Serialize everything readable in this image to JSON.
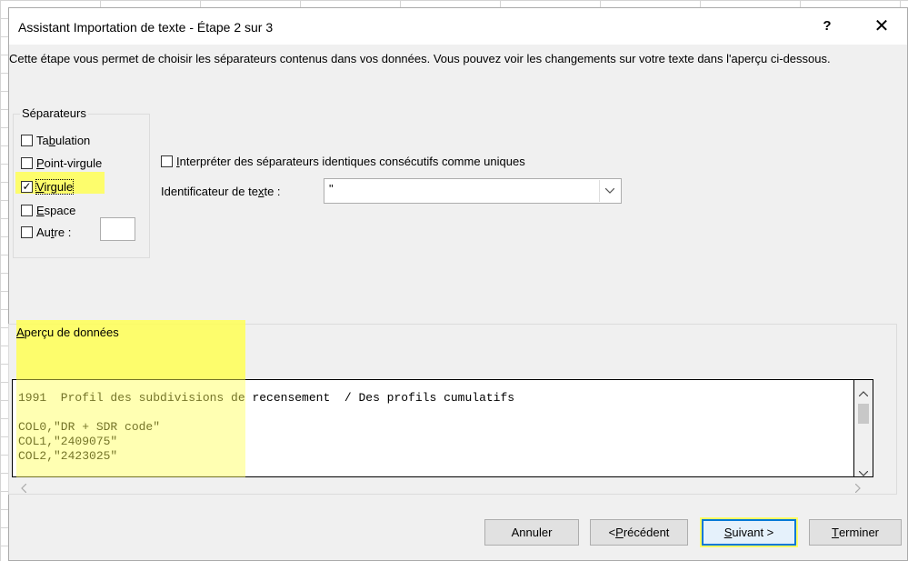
{
  "dialog": {
    "title": "Assistant Importation de texte - Étape 2 sur 3",
    "help_label": "?",
    "close_label": "✕",
    "description": "Cette étape vous permet de choisir les séparateurs contenus dans vos données. Vous pouvez voir les changements sur votre texte dans l'aperçu ci-dessous."
  },
  "separators": {
    "group_label": "Séparateurs",
    "tab": {
      "pre": "Ta",
      "u": "b",
      "post": "ulation",
      "checked": false
    },
    "semicolon": {
      "pre": "",
      "u": "P",
      "post": "oint-virgule",
      "checked": false
    },
    "comma": {
      "pre": "",
      "u": "V",
      "post": "irgule",
      "checked": true
    },
    "space": {
      "pre": "",
      "u": "E",
      "post": "space",
      "checked": false
    },
    "other": {
      "pre": "Au",
      "u": "t",
      "post": "re :",
      "checked": false,
      "value": ""
    }
  },
  "consecutive": {
    "pre": "",
    "u": "I",
    "post": "nterpréter des séparateurs identiques consécutifs comme uniques",
    "checked": false
  },
  "text_qualifier": {
    "pre": "Identificateur de te",
    "u": "x",
    "post": "te :",
    "value": "\""
  },
  "preview": {
    "group_label_u": "A",
    "group_label_rest": "perçu de données",
    "lines": [
      "1991  Profil des subdivisions de recensement  / Des profils cumulatifs",
      "",
      "COL0,\"DR + SDR code\"",
      "COL1,\"2409075\"",
      "COL2,\"2423025\""
    ]
  },
  "buttons": {
    "cancel": "Annuler",
    "prev_pre": "< ",
    "prev_u": "P",
    "prev_post": "récédent",
    "next_u": "S",
    "next_post": "uivant >",
    "finish_u": "T",
    "finish_post": "erminer"
  },
  "colors": {
    "highlight": "#ffff66",
    "accent": "#0078d7"
  }
}
